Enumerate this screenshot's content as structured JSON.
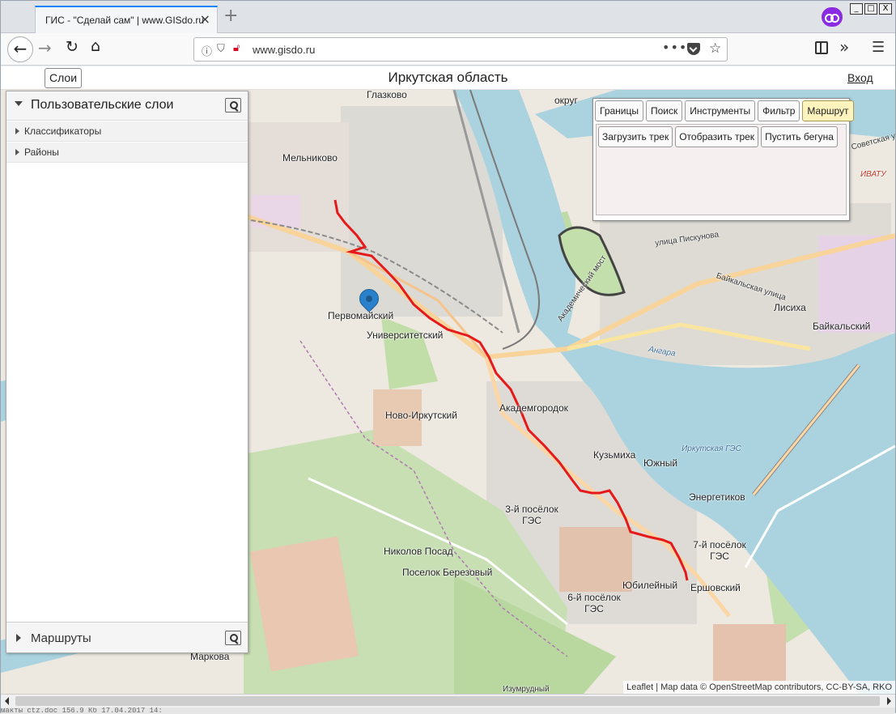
{
  "browser": {
    "tab_title": "ГИС - \"Сделай сам\" | www.GISdo.ru",
    "tab_close": "×",
    "new_tab": "+",
    "url": "www.gisdo.ru",
    "url_more": "•••",
    "window_buttons": [
      "_",
      "□",
      "X"
    ]
  },
  "header": {
    "layers_button": "Слои",
    "title": "Иркутская область",
    "login": "Вход"
  },
  "left_panel": {
    "title": "Пользовательские слои",
    "items": [
      {
        "label": "Классификаторы"
      },
      {
        "label": "Районы"
      }
    ],
    "footer_title": "Маршруты"
  },
  "toolbox": {
    "tabs": [
      "Границы",
      "Поиск",
      "Инструменты",
      "Фильтр",
      "Маршрут"
    ],
    "active_tab": "Маршрут",
    "actions": [
      "Загрузить трек",
      "Отобразить трек",
      "Пустить бегуна"
    ]
  },
  "map": {
    "places": [
      {
        "name": "Глазково"
      },
      {
        "name": "округ"
      },
      {
        "name": "Мельниково"
      },
      {
        "name": "Первомайский"
      },
      {
        "name": "Университетский"
      },
      {
        "name": "Лисиха"
      },
      {
        "name": "Байкальский"
      },
      {
        "name": "Академгородок"
      },
      {
        "name": "Ново-Иркутский"
      },
      {
        "name": "Кузьмиха"
      },
      {
        "name": "Южный"
      },
      {
        "name": "Энергетиков"
      },
      {
        "name": "3-й посёлок ГЭС"
      },
      {
        "name": "Николов Посад"
      },
      {
        "name": "Поселок Березовый"
      },
      {
        "name": "7-й посёлок ГЭС"
      },
      {
        "name": "Юбилейный"
      },
      {
        "name": "Ершовский"
      },
      {
        "name": "6-й посёлок ГЭС"
      },
      {
        "name": "Маркова"
      },
      {
        "name": "Изумрудный"
      }
    ],
    "streets": [
      {
        "name": "улица Пискунова"
      },
      {
        "name": "Байкальская улица"
      },
      {
        "name": "Академический мост"
      },
      {
        "name": "Иркутская ГЭС"
      },
      {
        "name": "ИВАТУ"
      },
      {
        "name": "Советская ул"
      },
      {
        "name": "Ангара"
      }
    ],
    "attribution": "Leaflet | Map data © OpenStreetMap contributors, CC-BY-SA, RKO"
  },
  "taskbar_text": "макты ctz.doc          156.9 Кб  17.04.2017 14:"
}
